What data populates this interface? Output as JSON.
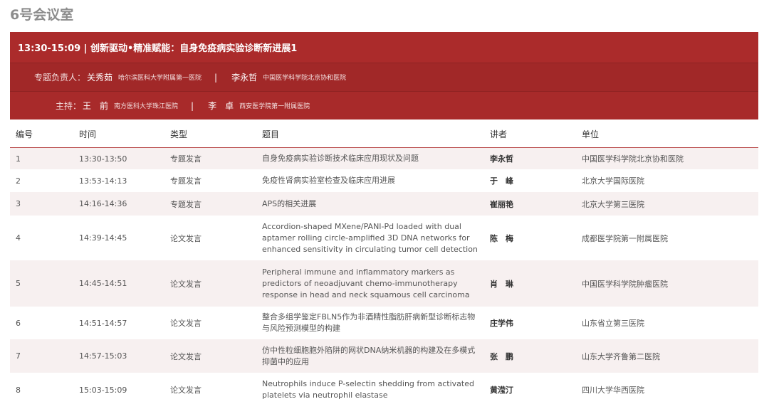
{
  "room": {
    "title": "6号会议室"
  },
  "session": {
    "title": "13:30-15:09 | 创新驱动•精准赋能：自身免疫病实验诊断新进展1",
    "leads_label": "专题负责人：",
    "leads": [
      {
        "name": "关秀茹",
        "hospital": "哈尔滨医科大学附属第一医院"
      },
      {
        "name": "李永哲",
        "hospital": "中国医学科学院北京协和医院"
      }
    ],
    "hosts_label": "主持：",
    "hosts": [
      {
        "name": "王　前",
        "hospital": "南方医科大学珠江医院"
      },
      {
        "name": "李　卓",
        "hospital": "西安医学院第一附属医院"
      }
    ],
    "separator": "|"
  },
  "table": {
    "headers": [
      "编号",
      "时间",
      "类型",
      "题目",
      "讲者",
      "单位"
    ],
    "rows": [
      {
        "no": "1",
        "time": "13:30-13:50",
        "type": "专题发言",
        "topic": "自身免疫病实验诊断技术临床应用现状及问题",
        "speaker": "李永哲",
        "unit": "中国医学科学院北京协和医院"
      },
      {
        "no": "2",
        "time": "13:53-14:13",
        "type": "专题发言",
        "topic": "免疫性肾病实验室检查及临床应用进展",
        "speaker": "于　峰",
        "unit": "北京大学国际医院"
      },
      {
        "no": "3",
        "time": "14:16-14:36",
        "type": "专题发言",
        "topic": "APS的相关进展",
        "speaker": "崔丽艳",
        "unit": "北京大学第三医院"
      },
      {
        "no": "4",
        "time": "14:39-14:45",
        "type": "论文发言",
        "topic": "Accordion-shaped MXene/PANI-Pd loaded with dual aptamer rolling circle-amplified 3D DNA networks for enhanced sensitivity in circulating tumor cell detection",
        "speaker": "陈　梅",
        "unit": "成都医学院第一附属医院"
      },
      {
        "no": "5",
        "time": "14:45-14:51",
        "type": "论文发言",
        "topic": "Peripheral immune and inflammatory markers as predictors of neoadjuvant chemo-immunotherapy response in head and neck squamous cell carcinoma",
        "speaker": "肖　琳",
        "unit": "中国医学科学院肿瘤医院"
      },
      {
        "no": "6",
        "time": "14:51-14:57",
        "type": "论文发言",
        "topic": "整合多组学鉴定FBLN5作为非酒精性脂肪肝病新型诊断标志物与风险预测模型的构建",
        "speaker": "庄学伟",
        "unit": "山东省立第三医院"
      },
      {
        "no": "7",
        "time": "14:57-15:03",
        "type": "论文发言",
        "topic": "仿中性粒细胞胞外陷阱的网状DNA纳米机器的构建及在多模式抑菌中的应用",
        "speaker": "张　鹏",
        "unit": "山东大学齐鲁第二医院"
      },
      {
        "no": "8",
        "time": "15:03-15:09",
        "type": "论文发言",
        "topic": "Neutrophils induce P-selectin shedding from activated platelets via neutrophil elastase",
        "speaker": "黄滢汀",
        "unit": "四川大学华西医院"
      }
    ]
  }
}
